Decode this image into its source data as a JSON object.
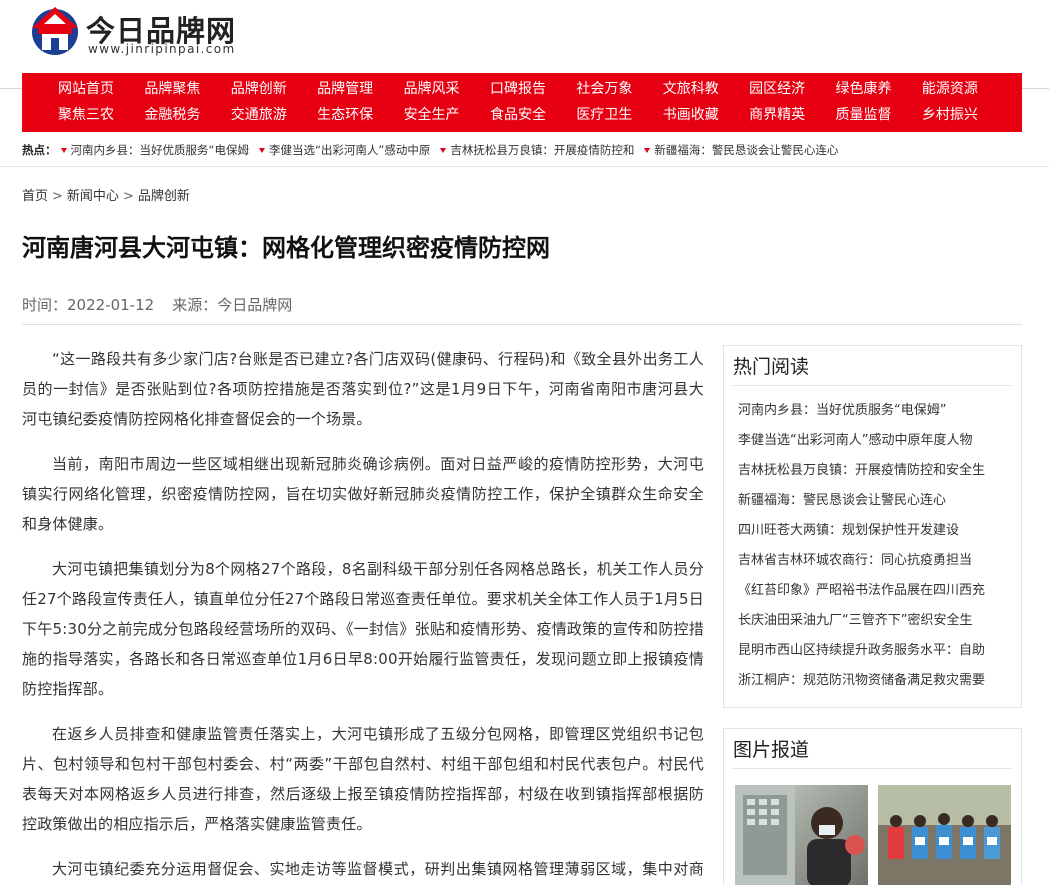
{
  "site": {
    "name": "今日品牌网",
    "url": "www.jinripinpai.com"
  },
  "nav": {
    "row1": [
      "网站首页",
      "品牌聚焦",
      "品牌创新",
      "品牌管理",
      "品牌风采",
      "口碑报告",
      "社会万象",
      "文旅科教",
      "园区经济",
      "绿色康养",
      "能源资源"
    ],
    "row2": [
      "聚焦三农",
      "金融税务",
      "交通旅游",
      "生态环保",
      "安全生产",
      "食品安全",
      "医疗卫生",
      "书画收藏",
      "商界精英",
      "质量监督",
      "乡村振兴"
    ]
  },
  "hot_bar": {
    "label": "热点：",
    "items": [
      "河南内乡县：当好优质服务“电保姆",
      "李健当选“出彩河南人”感动中原",
      "吉林抚松县万良镇：开展疫情防控和",
      "新疆福海：警民恳谈会让警民心连心"
    ]
  },
  "breadcrumb": [
    "首页",
    "新闻中心",
    "品牌创新"
  ],
  "breadcrumb_sep": ">",
  "article": {
    "title": "河南唐河县大河屯镇：网格化管理织密疫情防控网",
    "time": "时间：2022-01-12",
    "source": "来源：今日品牌网",
    "paragraphs": [
      "“这一路段共有多少家门店?台账是否已建立?各门店双码(健康码、行程码)和《致全县外出务工人员的一封信》是否张贴到位?各项防控措施是否落实到位?”这是1月9日下午，河南省南阳市唐河县大河屯镇纪委疫情防控网格化排查督促会的一个场景。",
      "当前，南阳市周边一些区域相继出现新冠肺炎确诊病例。面对日益严峻的疫情防控形势，大河屯镇实行网络化管理，织密疫情防控网，旨在切实做好新冠肺炎疫情防控工作，保护全镇群众生命安全和身体健康。",
      "大河屯镇把集镇划分为8个网格27个路段，8名副科级干部分别任各网格总路长，机关工作人员分任27个路段宣传责任人，镇直单位分任27个路段日常巡查责任单位。要求机关全体工作人员于1月5日下午5:30分之前完成分包路段经营场所的双码、《一封信》张贴和疫情形势、疫情政策的宣传和防控措施的指导落实，各路长和各日常巡查单位1月6日早8:00开始履行监管责任，发现问题立即上报镇疫情防控指挥部。",
      "在返乡人员排查和健康监管责任落实上，大河屯镇形成了五级分包网格，即管理区党组织书记包片、包村领导和包村干部包村委会、村“两委”干部包自然村、村组干部包组和村民代表包户。村民代表每天对本网格返乡人员进行排查，然后逐级上报至镇疫情防控指挥部，村级在收到镇指挥部根据防控政策做出的相应指示后，严格落实健康监管责任。",
      "大河屯镇纪委充分运用督促会、实地走访等监督模式，研判出集镇网格管理薄弱区域，集中对商超、饭店、宾馆等重点区域的网格化管理落实情况进行实地检查，对发现的问题，及时向镇"
    ]
  },
  "sidebar": {
    "hot_read": {
      "title": "热门阅读",
      "items": [
        "河南内乡县：当好优质服务“电保姆”",
        "李健当选“出彩河南人”感动中原年度人物",
        "吉林抚松县万良镇：开展疫情防控和安全生",
        "新疆福海：警民恳谈会让警民心连心",
        "四川旺苍大两镇：规划保护性开发建设",
        "吉林省吉林环城农商行：同心抗疫勇担当",
        "《红苔印象》严昭裕书法作品展在四川西充",
        "长庆油田采油九厂“三管齐下”密织安全生",
        "昆明市西山区持续提升政务服务水平：自助",
        "浙江桐庐：规范防汛物资储备满足救灾需要"
      ]
    },
    "photo_news": {
      "title": "图片报道"
    }
  },
  "colors": {
    "nav_bg": "#e60012",
    "logo_red": "#e60012",
    "logo_blue": "#1c3f94"
  }
}
